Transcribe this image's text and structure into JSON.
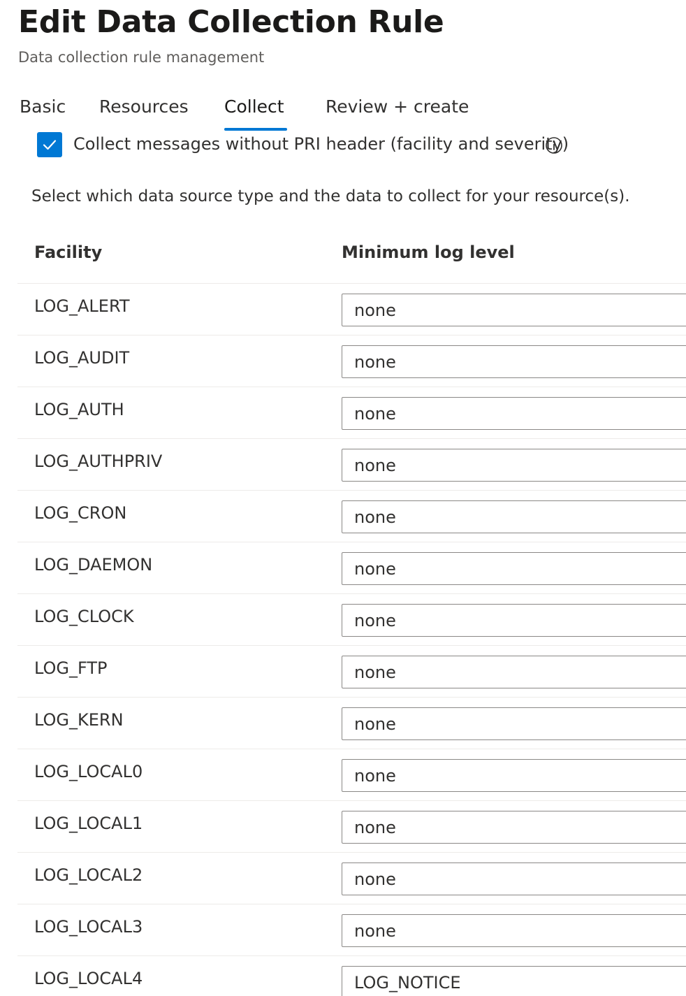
{
  "header": {
    "title": "Edit Data Collection Rule",
    "subtitle": "Data collection rule management"
  },
  "tabs": [
    {
      "label": "Basic",
      "active": false
    },
    {
      "label": "Resources",
      "active": false
    },
    {
      "label": "Collect",
      "active": true
    },
    {
      "label": "Review + create",
      "active": false
    }
  ],
  "options": {
    "collect_without_pri_label": "Collect messages without PRI header (facility and severity)",
    "collect_without_pri_checked": true
  },
  "description": "Select which data source type and the data to collect for your resource(s).",
  "table": {
    "columns": [
      "Facility",
      "Minimum log level"
    ],
    "rows": [
      {
        "facility": "LOG_ALERT",
        "level": "none"
      },
      {
        "facility": "LOG_AUDIT",
        "level": "none"
      },
      {
        "facility": "LOG_AUTH",
        "level": "none"
      },
      {
        "facility": "LOG_AUTHPRIV",
        "level": "none"
      },
      {
        "facility": "LOG_CRON",
        "level": "none"
      },
      {
        "facility": "LOG_DAEMON",
        "level": "none"
      },
      {
        "facility": "LOG_CLOCK",
        "level": "none"
      },
      {
        "facility": "LOG_FTP",
        "level": "none"
      },
      {
        "facility": "LOG_KERN",
        "level": "none"
      },
      {
        "facility": "LOG_LOCAL0",
        "level": "none"
      },
      {
        "facility": "LOG_LOCAL1",
        "level": "none"
      },
      {
        "facility": "LOG_LOCAL2",
        "level": "none"
      },
      {
        "facility": "LOG_LOCAL3",
        "level": "none"
      },
      {
        "facility": "LOG_LOCAL4",
        "level": "LOG_NOTICE"
      }
    ]
  },
  "colors": {
    "accent": "#0078d4",
    "text": "#323130",
    "border": "#8a8886",
    "divider": "#edebe9"
  },
  "icons": {
    "checkbox": "checkmark-icon",
    "info": "info-icon"
  }
}
